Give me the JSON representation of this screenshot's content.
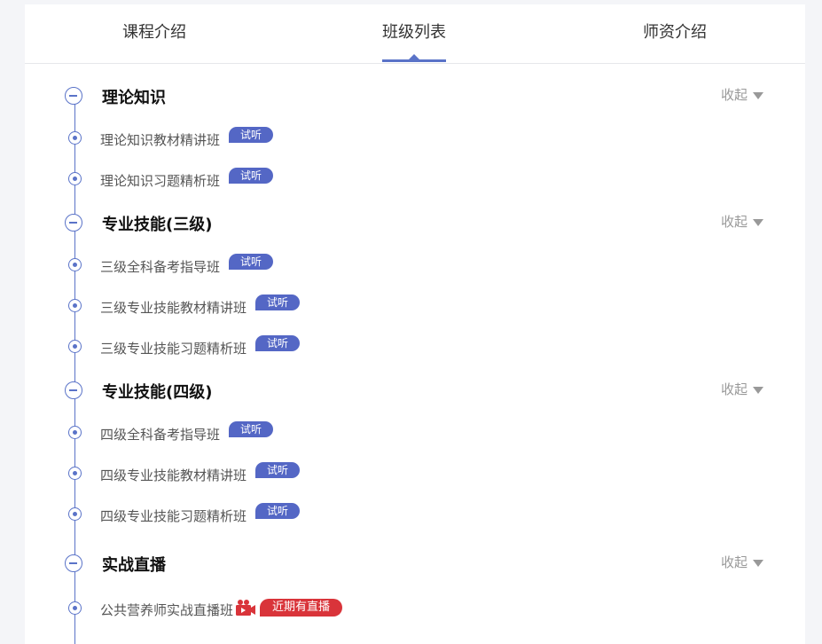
{
  "tabs": [
    "课程介绍",
    "班级列表",
    "师资介绍"
  ],
  "active_tab": 1,
  "accent_color": "#5a73c8",
  "collapse_label": "收起",
  "trial_label": "试听",
  "live_label": "近期有直播",
  "sections": [
    {
      "title": "理论知识",
      "items": [
        "理论知识教材精讲班",
        "理论知识习题精析班"
      ]
    },
    {
      "title": "专业技能(三级)",
      "items": [
        "三级全科备考指导班",
        "三级专业技能教材精讲班",
        "三级专业技能习题精析班"
      ]
    },
    {
      "title": "专业技能(四级)",
      "items": [
        "四级全科备考指导班",
        "四级专业技能教材精讲班",
        "四级专业技能习题精析班"
      ]
    },
    {
      "title": "实战直播",
      "items": [
        "公共营养师实战直播班"
      ]
    }
  ]
}
